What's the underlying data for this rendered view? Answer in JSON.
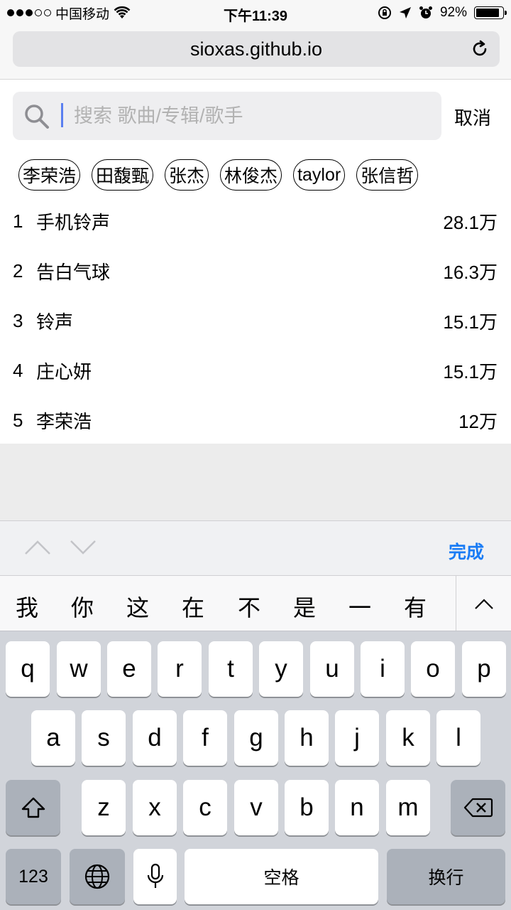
{
  "status_bar": {
    "carrier": "中国移动",
    "time": "下午11:39",
    "battery": "92%"
  },
  "browser": {
    "url": "sioxas.github.io"
  },
  "search": {
    "placeholder": "搜索 歌曲/专辑/歌手",
    "cancel_label": "取消"
  },
  "hot_tags": [
    "李荣浩",
    "田馥甄",
    "张杰",
    "林俊杰",
    "taylor",
    "张信哲"
  ],
  "hot_list": [
    {
      "rank": "1",
      "title": "手机铃声",
      "count": "28.1万"
    },
    {
      "rank": "2",
      "title": "告白气球",
      "count": "16.3万"
    },
    {
      "rank": "3",
      "title": "铃声",
      "count": "15.1万"
    },
    {
      "rank": "4",
      "title": "庄心妍",
      "count": "15.1万"
    },
    {
      "rank": "5",
      "title": "李荣浩",
      "count": "12万"
    }
  ],
  "accessory": {
    "done_label": "完成"
  },
  "candidates": [
    "我",
    "你",
    "这",
    "在",
    "不",
    "是",
    "一",
    "有"
  ],
  "keyboard": {
    "row1": [
      "q",
      "w",
      "e",
      "r",
      "t",
      "y",
      "u",
      "i",
      "o",
      "p"
    ],
    "row2": [
      "a",
      "s",
      "d",
      "f",
      "g",
      "h",
      "j",
      "k",
      "l"
    ],
    "row3": [
      "z",
      "x",
      "c",
      "v",
      "b",
      "n",
      "m"
    ],
    "numbers_label": "123",
    "space_label": "空格",
    "return_label": "换行"
  },
  "icons": {
    "search": "search-icon",
    "reload": "reload-icon",
    "globe": "globe-icon",
    "mic": "microphone-icon",
    "shift": "shift-icon",
    "backspace": "backspace-icon"
  }
}
